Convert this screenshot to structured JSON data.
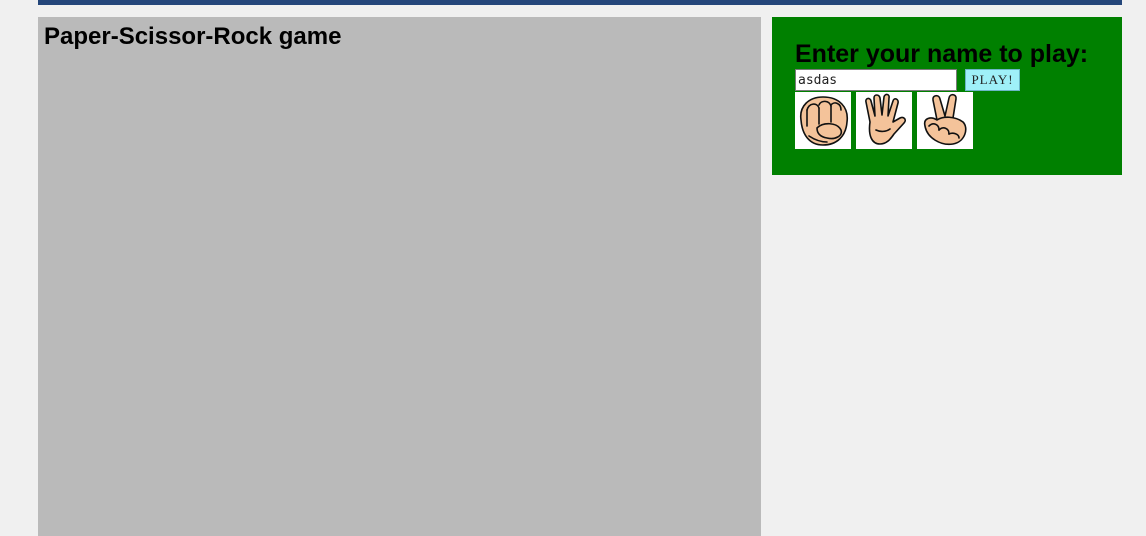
{
  "game": {
    "title": "Paper-Scissor-Rock game"
  },
  "play": {
    "heading": "Enter your name to play:",
    "name_value": "asdas",
    "button_label": "PLAY!",
    "choices": [
      "rock-icon",
      "paper-icon",
      "scissors-icon"
    ]
  },
  "colors": {
    "top_bar": "#24467a",
    "game_panel": "#bababa",
    "play_panel": "#008000",
    "play_button": "#9ff0f8",
    "skin": "#f4c39a"
  }
}
